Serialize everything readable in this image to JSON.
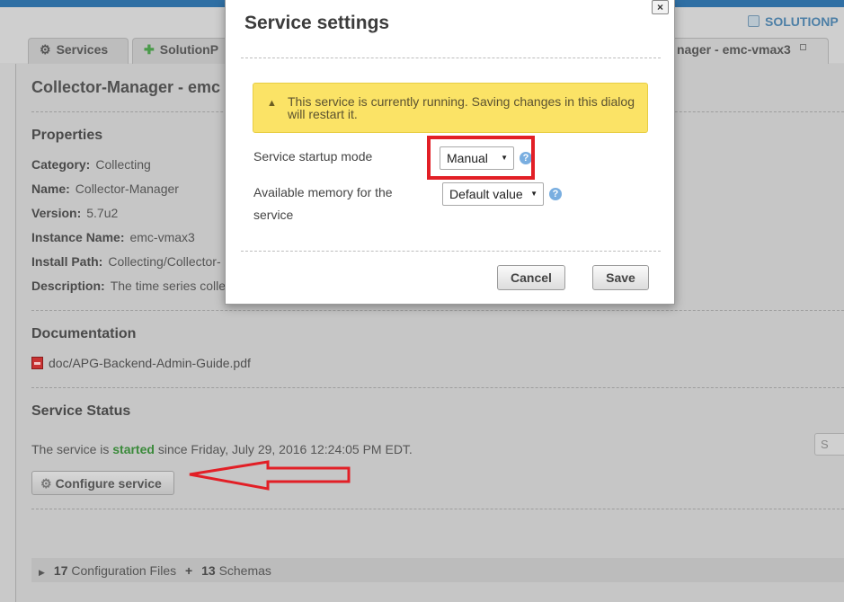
{
  "brand": {
    "name": "SOLUTIONP"
  },
  "tabs": [
    {
      "label": "Services",
      "icon": "gear-icon"
    },
    {
      "label": "SolutionP",
      "icon": "puzzle-icon"
    },
    {
      "label": "nager - emc-vmax3",
      "icon": "close-icon"
    }
  ],
  "page": {
    "title": "Collector-Manager - emc",
    "properties_heading": "Properties",
    "properties": [
      {
        "label": "Category:",
        "value": "Collecting"
      },
      {
        "label": "Name:",
        "value": "Collector-Manager"
      },
      {
        "label": "Version:",
        "value": "5.7u2"
      },
      {
        "label": "Instance Name:",
        "value": "emc-vmax3"
      },
      {
        "label": "Install Path:",
        "value": "Collecting/Collector-"
      },
      {
        "label": "Description:",
        "value": "The time series colle"
      }
    ],
    "documentation_heading": "Documentation",
    "doc_link": "doc/APG-Backend-Admin-Guide.pdf",
    "status_heading": "Service Status",
    "status": {
      "prefix": "The service is",
      "state": "started",
      "suffix": "since Friday, July 29, 2016 12:24:05 PM EDT."
    },
    "configure_button": "Configure service",
    "side_button": "S",
    "footer": {
      "config_count": "17",
      "config_label": "Configuration Files",
      "plus": "+",
      "schema_count": "13",
      "schema_label": "Schemas"
    }
  },
  "modal": {
    "title": "Service settings",
    "close_label": "×",
    "warning": "This service is currently running. Saving changes in this dialog will restart it.",
    "startup_label": "Service startup mode",
    "startup_value": "Manual",
    "memory_label": "Available memory for the service",
    "memory_value": "Default value",
    "cancel_label": "Cancel",
    "save_label": "Save"
  },
  "colors": {
    "accent": "#2f6fa4",
    "warning_bg": "#fbe366",
    "highlight": "#e21f26",
    "started": "#3a8a3a"
  }
}
